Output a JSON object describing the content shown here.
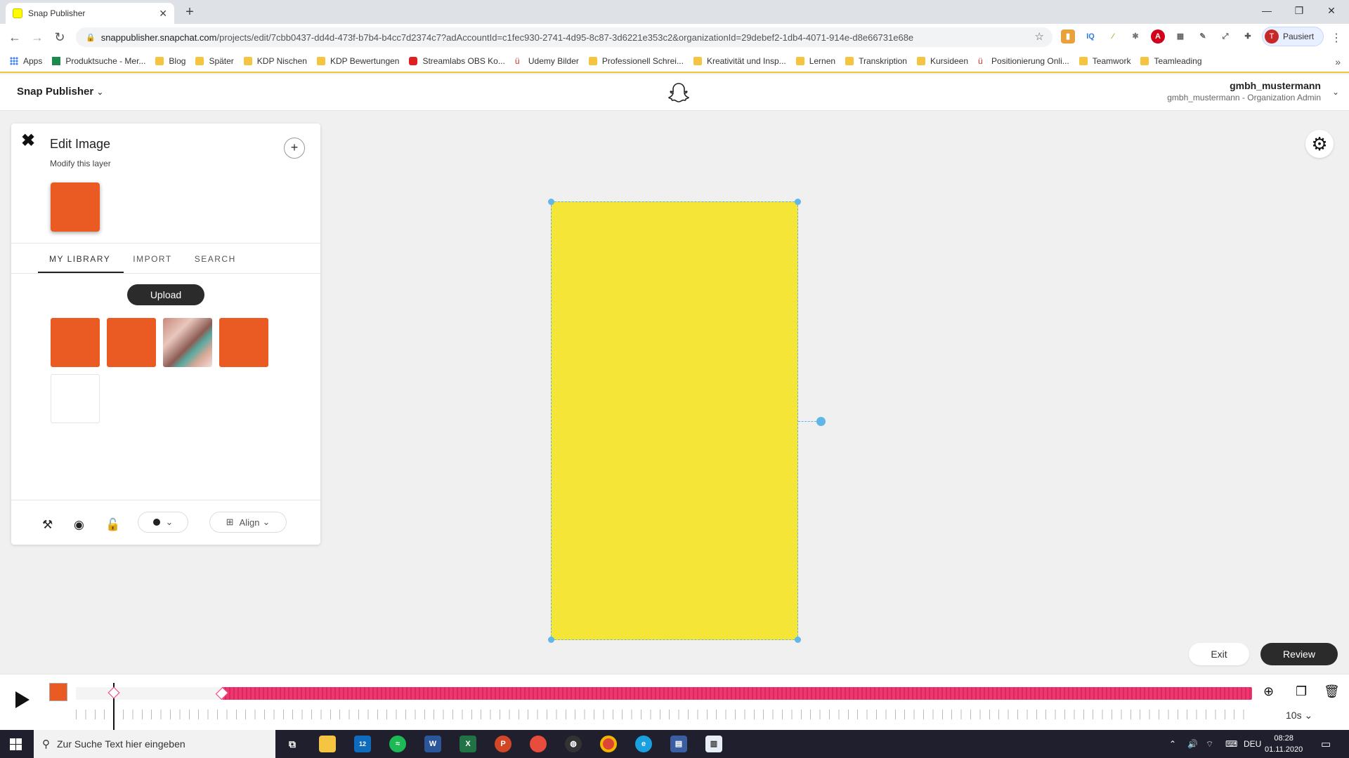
{
  "browser": {
    "tab_title": "Snap Publisher",
    "new_tab": "+",
    "url_host": "snappublisher.snapchat.com",
    "url_rest": "/projects/edit/7cbb0437-dd4d-473f-b7b4-b4cc7d2374c7?adAccountId=c1fec930-2741-4d95-8c87-3d6221e353c2&organizationId=29debef2-1db4-4071-914e-d8e66731e68e",
    "profile_initial": "T",
    "profile_status": "Pausiert",
    "bookmarks": [
      {
        "label": "Apps",
        "icon": "apps-grid-icon"
      },
      {
        "label": "Produktsuche - Mer...",
        "icon": "site-icon"
      },
      {
        "label": "Blog",
        "icon": "folder-icon"
      },
      {
        "label": "Später",
        "icon": "folder-icon"
      },
      {
        "label": "KDP Nischen",
        "icon": "folder-icon"
      },
      {
        "label": "KDP Bewertungen",
        "icon": "folder-icon"
      },
      {
        "label": "Streamlabs OBS Ko...",
        "icon": "youtube-icon"
      },
      {
        "label": "Udemy Bilder",
        "icon": "udemy-icon"
      },
      {
        "label": "Professionell Schrei...",
        "icon": "folder-icon"
      },
      {
        "label": "Kreativität und Insp...",
        "icon": "folder-icon"
      },
      {
        "label": "Lernen",
        "icon": "folder-icon"
      },
      {
        "label": "Transkription",
        "icon": "folder-icon"
      },
      {
        "label": "Kursideen",
        "icon": "folder-icon"
      },
      {
        "label": "Positionierung Onli...",
        "icon": "udemy-icon"
      },
      {
        "label": "Teamwork",
        "icon": "folder-icon"
      },
      {
        "label": "Teamleading",
        "icon": "folder-icon"
      }
    ]
  },
  "app": {
    "brand": "Snap Publisher",
    "user_name": "gmbh_mustermann",
    "user_role": "gmbh_mustermann - Organization Admin"
  },
  "panel": {
    "title": "Edit Image",
    "subtitle": "Modify this layer",
    "tabs": [
      "MY LIBRARY",
      "IMPORT",
      "SEARCH"
    ],
    "active_tab": "MY LIBRARY",
    "upload_label": "Upload",
    "align_label": "Align"
  },
  "actions": {
    "exit_label": "Exit",
    "review_label": "Review"
  },
  "timeline": {
    "duration": "10s"
  },
  "taskbar": {
    "search_placeholder": "Zur Suche Text hier eingeben",
    "language": "DEU",
    "time": "08:28",
    "date": "01.11.2020",
    "mail_badge": "12"
  },
  "colors": {
    "canvas_yellow": "#f5e536",
    "accent_orange": "#ea5b24",
    "timeline_pink": "#f0366e",
    "selection_blue": "#5fb6e8"
  }
}
